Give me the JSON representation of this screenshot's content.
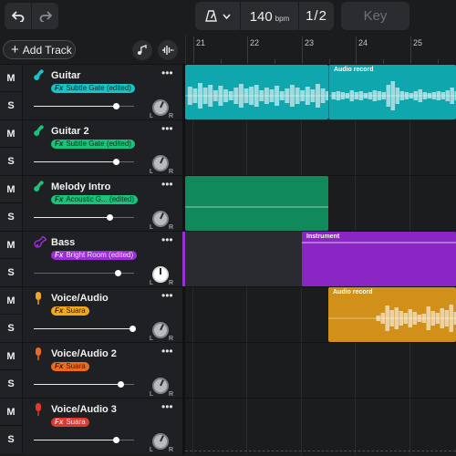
{
  "toolbar": {
    "undo": "undo-icon",
    "redo": "redo-icon",
    "metronome": "metronome-icon",
    "bpm_value": "140",
    "bpm_unit": "bpm",
    "time_signature": "1/2",
    "key_label": "Key"
  },
  "header": {
    "add_track_label": "Add Track",
    "tools": [
      "note-tool-icon",
      "waveform-tool-icon"
    ]
  },
  "ruler": {
    "bars": [
      "21",
      "22",
      "23",
      "24",
      "25"
    ]
  },
  "tracks": [
    {
      "name": "Guitar",
      "fx_prefix": "Fx",
      "fx": "Subtle Gate (edited)",
      "mute": "M",
      "solo": "S",
      "volume": 0.82,
      "icon": "guitar-icon",
      "color": "#16c3c9",
      "clips": [
        {
          "label": "",
          "color": "#10a6ad"
        },
        {
          "label": "Audio record",
          "color": "#10a6ad"
        }
      ]
    },
    {
      "name": "Guitar 2",
      "fx_prefix": "Fx",
      "fx": "Subtle Gate (edited)",
      "mute": "M",
      "solo": "S",
      "volume": 0.82,
      "icon": "guitar-icon",
      "color": "#17c47a",
      "clips": []
    },
    {
      "name": "Melody Intro",
      "fx_prefix": "Fx",
      "fx": "Acoustic G... (edited)",
      "mute": "M",
      "solo": "S",
      "volume": 0.75,
      "icon": "guitar-icon",
      "color": "#17c47a",
      "clips": [
        {
          "label": "",
          "color": "#118a5b"
        }
      ]
    },
    {
      "name": "Bass",
      "fx_prefix": "Fx",
      "fx": "Bright Room (edited)",
      "mute": "M",
      "solo": "S",
      "volume": 0.84,
      "icon": "bass-guitar-icon",
      "color": "#9b2fd6",
      "clips": [
        {
          "label": "Instrument",
          "color": "#8a27c4"
        }
      ]
    },
    {
      "name": "Voice/Audio",
      "fx_prefix": "Fx",
      "fx": "Suara",
      "mute": "M",
      "solo": "S",
      "volume": 0.98,
      "icon": "microphone-icon",
      "color": "#f3a81b",
      "clips": [
        {
          "label": "Audio record",
          "color": "#d0901a"
        }
      ]
    },
    {
      "name": "Voice/Audio 2",
      "fx_prefix": "Fx",
      "fx": "Suara",
      "mute": "M",
      "solo": "S",
      "volume": 0.86,
      "icon": "microphone-icon",
      "color": "#ee6a1f",
      "clips": []
    },
    {
      "name": "Voice/Audio 3",
      "fx_prefix": "Fx",
      "fx": "Suara",
      "mute": "M",
      "solo": "S",
      "volume": 0.82,
      "icon": "microphone-icon",
      "color": "#e03a2a",
      "clips": []
    }
  ]
}
